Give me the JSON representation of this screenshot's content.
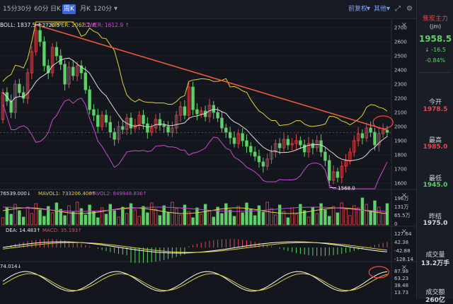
{
  "toolbar": {
    "tabs": [
      {
        "label": "15分",
        "active": false
      },
      {
        "label": "30分",
        "active": false
      },
      {
        "label": "60分",
        "active": false
      },
      {
        "label": "日K",
        "active": false
      },
      {
        "label": "周K",
        "active": true
      },
      {
        "label": "月K",
        "active": false
      },
      {
        "label": "120分",
        "active": false
      }
    ],
    "dropdown_arrow": "▾",
    "adjust_label": "前复权",
    "other_label": "其他",
    "expand_icon": "⤢",
    "settings_icon": "⚙"
  },
  "boll": {
    "boll_label": "BOLL: 1837.5",
    "upper_label": "UPPER: 2062.1",
    "lower_label": "LOWER: 1612.9",
    "arrow": "↑",
    "arrow_down": "↓",
    "high_mark": "2720.5",
    "low_mark": "1568.0"
  },
  "vol_panel": {
    "vol_label": "76539.000↓",
    "mavol1_label": "MAVOL1: 733206.400↑",
    "mavol2_label": "MAVOL2: 849848.830↑",
    "ticks": [
      "196万",
      "131万",
      "65.5万",
      "0"
    ]
  },
  "macd_panel": {
    "dea_label": "DEA: 14.483↑",
    "macd_label": "MACD: 35.193↑",
    "ticks": [
      "127.64",
      "42.38",
      "-42.88",
      "-128.14"
    ]
  },
  "kdj_panel": {
    "label": "74.014↓",
    "ticks": [
      "87.98",
      "63.23",
      "38.48",
      "13.73"
    ]
  },
  "close_icon": "×",
  "right_panel": {
    "name": "焦炭主力",
    "code": "(jm)",
    "price": "1958.5",
    "change_arrow": "↓",
    "change": "-16.5",
    "pct": "-0.84%",
    "open_label": "今开",
    "open": "1978.5",
    "high_label": "最高",
    "high": "1985.0",
    "low_label": "最低",
    "low": "1945.0",
    "prev_label": "昨结",
    "prev": "1975.0",
    "volume_label": "成交量",
    "volume": "13.2万手",
    "amount_label": "成交额",
    "amount": "260亿"
  },
  "colors": {
    "up": "#e5484d",
    "down": "#5fd068",
    "upper": "#e0d23a",
    "mid": "#dddddd",
    "lower": "#c94bd2",
    "trend": "#ef5a3a",
    "accent": "#3b64d8"
  },
  "chart_data": {
    "type": "candlestick",
    "timeframe": "周K",
    "price_axis": {
      "ticks": [
        2700,
        2600,
        2500,
        2400,
        2300,
        2200,
        2100,
        2000,
        1900,
        1800,
        1700,
        1600
      ],
      "range": [
        1560,
        2740
      ]
    },
    "highest": 2720.5,
    "lowest": 1568.0,
    "last_price": 1958.5,
    "boll": {
      "mid": 1837.5,
      "upper": 2062.1,
      "lower": 1612.9
    },
    "candles": [
      [
        2050,
        2240
      ],
      [
        2240,
        2180
      ],
      [
        2180,
        2100
      ],
      [
        2100,
        2300
      ],
      [
        2300,
        2240
      ],
      [
        2240,
        2200
      ],
      [
        2200,
        2380
      ],
      [
        2380,
        2530
      ],
      [
        2530,
        2680
      ],
      [
        2680,
        2600
      ],
      [
        2600,
        2430
      ],
      [
        2430,
        2380
      ],
      [
        2380,
        2560
      ],
      [
        2560,
        2500
      ],
      [
        2500,
        2440
      ],
      [
        2440,
        2300
      ],
      [
        2300,
        2420
      ],
      [
        2420,
        2360
      ],
      [
        2360,
        2430
      ],
      [
        2430,
        2380
      ],
      [
        2380,
        2260
      ],
      [
        2260,
        2120
      ],
      [
        2120,
        2080
      ],
      [
        2080,
        2000
      ],
      [
        2000,
        2080
      ],
      [
        2080,
        2030
      ],
      [
        2030,
        1960
      ],
      [
        1960,
        1910
      ],
      [
        1910,
        2000
      ],
      [
        2000,
        1980
      ],
      [
        1980,
        2060
      ],
      [
        2060,
        1990
      ],
      [
        1990,
        2010
      ],
      [
        2010,
        2080
      ],
      [
        2080,
        2020
      ],
      [
        2020,
        1960
      ],
      [
        1960,
        1990
      ],
      [
        1990,
        2050
      ],
      [
        2050,
        2010
      ],
      [
        2010,
        2000
      ],
      [
        2000,
        1960
      ],
      [
        1960,
        1990
      ],
      [
        1990,
        2080
      ],
      [
        2080,
        2140
      ],
      [
        2140,
        2080
      ],
      [
        2080,
        2280
      ],
      [
        2280,
        2120
      ],
      [
        2120,
        2090
      ],
      [
        2090,
        2110
      ],
      [
        2110,
        2070
      ],
      [
        2070,
        2150
      ],
      [
        2150,
        2100
      ],
      [
        2100,
        2060
      ],
      [
        2060,
        1990
      ],
      [
        1990,
        1960
      ],
      [
        1960,
        1920
      ],
      [
        1920,
        1880
      ],
      [
        1880,
        1950
      ],
      [
        1950,
        1900
      ],
      [
        1900,
        1860
      ],
      [
        1860,
        1820
      ],
      [
        1820,
        1790
      ],
      [
        1790,
        1750
      ],
      [
        1750,
        1720
      ],
      [
        1720,
        1770
      ],
      [
        1770,
        1820
      ],
      [
        1820,
        1880
      ],
      [
        1880,
        1850
      ],
      [
        1850,
        1910
      ],
      [
        1910,
        1870
      ],
      [
        1870,
        1880
      ],
      [
        1880,
        1900
      ],
      [
        1900,
        1870
      ],
      [
        1870,
        1820
      ],
      [
        1820,
        1880
      ],
      [
        1880,
        1850
      ],
      [
        1850,
        1900
      ],
      [
        1900,
        1820
      ],
      [
        1820,
        1760
      ],
      [
        1760,
        1620
      ],
      [
        1620,
        1680
      ],
      [
        1680,
        1640
      ],
      [
        1640,
        1720
      ],
      [
        1720,
        1760
      ],
      [
        1760,
        1820
      ],
      [
        1820,
        1900
      ],
      [
        1900,
        1950
      ],
      [
        1950,
        1920
      ],
      [
        1920,
        1990
      ],
      [
        1990,
        1960
      ],
      [
        1960,
        1870
      ],
      [
        1870,
        1950
      ],
      [
        1950,
        1975
      ],
      [
        1975,
        1958.5
      ]
    ],
    "volume_axis_ticks": [
      "196万",
      "131万",
      "65.5万",
      "0"
    ],
    "macd_axis_ticks": [
      127.64,
      42.38,
      -42.88,
      -128.14
    ],
    "kdj_axis_ticks": [
      87.98,
      63.23,
      38.48,
      13.73
    ]
  }
}
